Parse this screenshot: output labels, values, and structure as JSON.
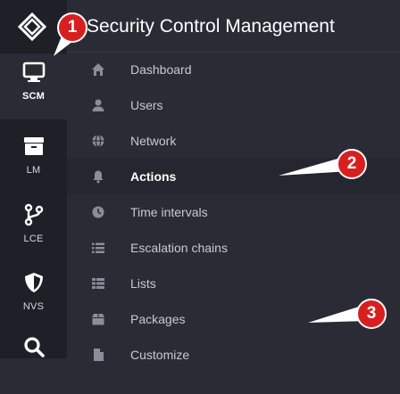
{
  "app": {
    "title": "Security Control Management"
  },
  "rail": {
    "items": [
      {
        "label": "SCM",
        "icon": "monitor-icon",
        "active": true
      },
      {
        "label": "LM",
        "icon": "archive-icon"
      },
      {
        "label": "LCE",
        "icon": "branch-icon"
      },
      {
        "label": "NVS",
        "icon": "shield-icon"
      },
      {
        "label": "",
        "icon": "search-icon"
      }
    ]
  },
  "menu": {
    "items": [
      {
        "label": "Dashboard",
        "icon": "home-icon"
      },
      {
        "label": "Users",
        "icon": "user-icon"
      },
      {
        "label": "Network",
        "icon": "globe-icon"
      },
      {
        "label": "Actions",
        "icon": "bell-icon",
        "active": true
      },
      {
        "label": "Time intervals",
        "icon": "clock-icon"
      },
      {
        "label": "Escalation chains",
        "icon": "list-icon"
      },
      {
        "label": "Lists",
        "icon": "list-details-icon"
      },
      {
        "label": "Packages",
        "icon": "box-icon"
      },
      {
        "label": "Customize",
        "icon": "file-icon"
      }
    ]
  },
  "annotations": {
    "badge1": "1",
    "badge2": "2",
    "badge3": "3"
  },
  "colors": {
    "sidebar_bg": "#1f1f28",
    "content_bg": "#2b2b36",
    "active_bg": "#262630",
    "callout_red": "#d81f1f"
  }
}
